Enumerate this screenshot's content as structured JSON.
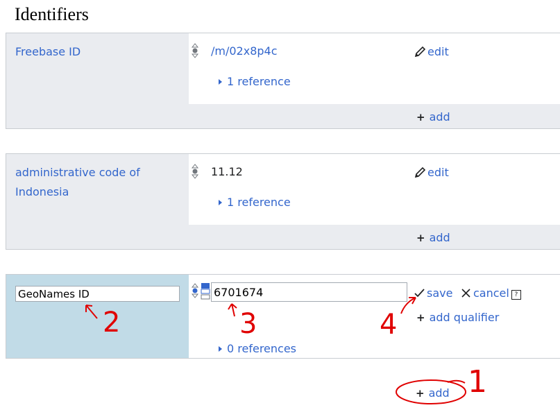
{
  "section": {
    "heading": "Identifiers"
  },
  "statements": [
    {
      "property": "Freebase ID",
      "value": "/m/02x8p4c",
      "edit_label": "edit",
      "references_label": "1 reference",
      "add_label": "add"
    },
    {
      "property": "administrative code of Indonesia",
      "value": "11.12",
      "edit_label": "edit",
      "references_label": "1 reference",
      "add_label": "add"
    }
  ],
  "new_statement": {
    "property_input_value": "GeoNames ID",
    "value_input_value": "6701674",
    "save_label": "save",
    "cancel_label": "cancel",
    "help_label": "?",
    "add_qualifier_label": "add qualifier",
    "references_label": "0 references"
  },
  "footer": {
    "add_label": "add"
  },
  "annotations": [
    "1",
    "2",
    "3",
    "4"
  ],
  "colors": {
    "link": "#3366cc",
    "panel_grey": "#eaecf0",
    "editing_blue": "#c1dbe7",
    "annotation_red": "#e00000"
  }
}
